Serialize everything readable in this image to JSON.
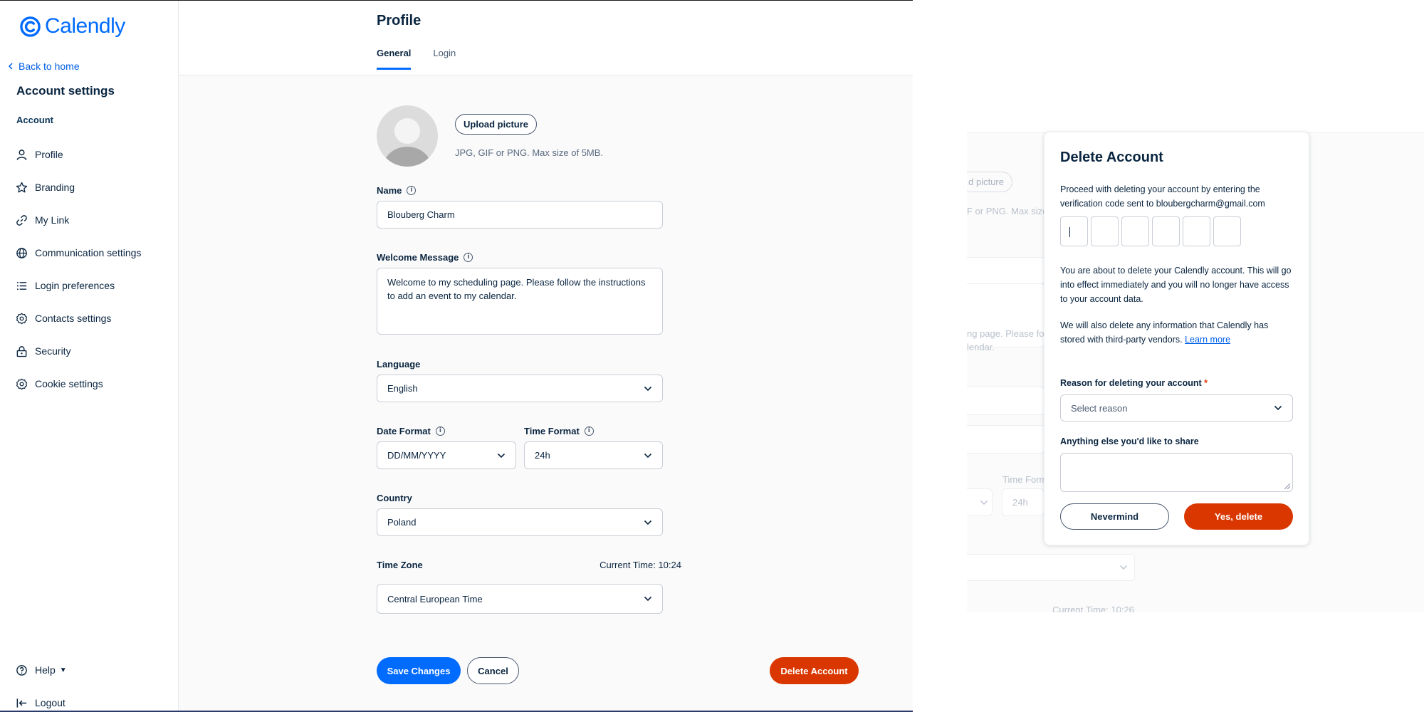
{
  "sidebar": {
    "logo": "Calendly",
    "back": "Back to home",
    "title": "Account settings",
    "section": "Account",
    "items": [
      {
        "label": "Profile",
        "icon": "user-icon"
      },
      {
        "label": "Branding",
        "icon": "star-icon"
      },
      {
        "label": "My Link",
        "icon": "link-icon"
      },
      {
        "label": "Communication settings",
        "icon": "globe-icon"
      },
      {
        "label": "Login preferences",
        "icon": "list-icon"
      },
      {
        "label": "Contacts settings",
        "icon": "gear-icon"
      },
      {
        "label": "Security",
        "icon": "lock-icon"
      },
      {
        "label": "Cookie settings",
        "icon": "gear-icon"
      }
    ],
    "help": "Help",
    "logout": "Logout"
  },
  "main": {
    "title": "Profile",
    "tabs": [
      {
        "label": "General"
      },
      {
        "label": "Login"
      }
    ],
    "upload_button": "Upload picture",
    "upload_hint": "JPG, GIF or PNG. Max size of 5MB.",
    "name_label": "Name",
    "name_value": "Blouberg Charm",
    "welcome_label": "Welcome Message",
    "welcome_value": "Welcome to my scheduling page. Please follow the instructions to add an event to my calendar.",
    "language_label": "Language",
    "language_value": "English",
    "date_label": "Date Format",
    "date_value": "DD/MM/YYYY",
    "time_label": "Time Format",
    "time_value": "24h",
    "country_label": "Country",
    "country_value": "Poland",
    "timezone_label": "Time Zone",
    "current_time_label": "Current Time:",
    "current_time_value": "10:24",
    "timezone_value": "Central European Time",
    "save_button": "Save Changes",
    "cancel_button": "Cancel",
    "delete_button": "Delete Account"
  },
  "background": {
    "upload_fragment": "d picture",
    "hint_fragment": "F or PNG. Max size",
    "welcome_fragment_1": "ng page. Please fo",
    "welcome_fragment_2": "lendar.",
    "time_format_fragment": "Time Form",
    "time_value_fragment": "24h",
    "current_time_fragment": "Current Time: 10:26"
  },
  "modal": {
    "title": "Delete Account",
    "intro": "Proceed with deleting your account by entering the verification code sent to bloubergcharm@gmail.com",
    "code_boxes": 6,
    "warning": "You are about to delete your Calendly account. This will go into effect immediately and you will no longer have access to your account data.",
    "third_party": "We will also delete any information that Calendly has stored with third-party vendors.",
    "learn_more": "Learn more",
    "reason_label": "Reason for deleting your account",
    "reason_required": "*",
    "reason_placeholder": "Select reason",
    "share_label": "Anything else you'd like to share",
    "nevermind_button": "Nevermind",
    "confirm_button": "Yes, delete"
  },
  "colors": {
    "brand": "#006bff",
    "danger": "#da3700",
    "text": "#0a2540"
  }
}
